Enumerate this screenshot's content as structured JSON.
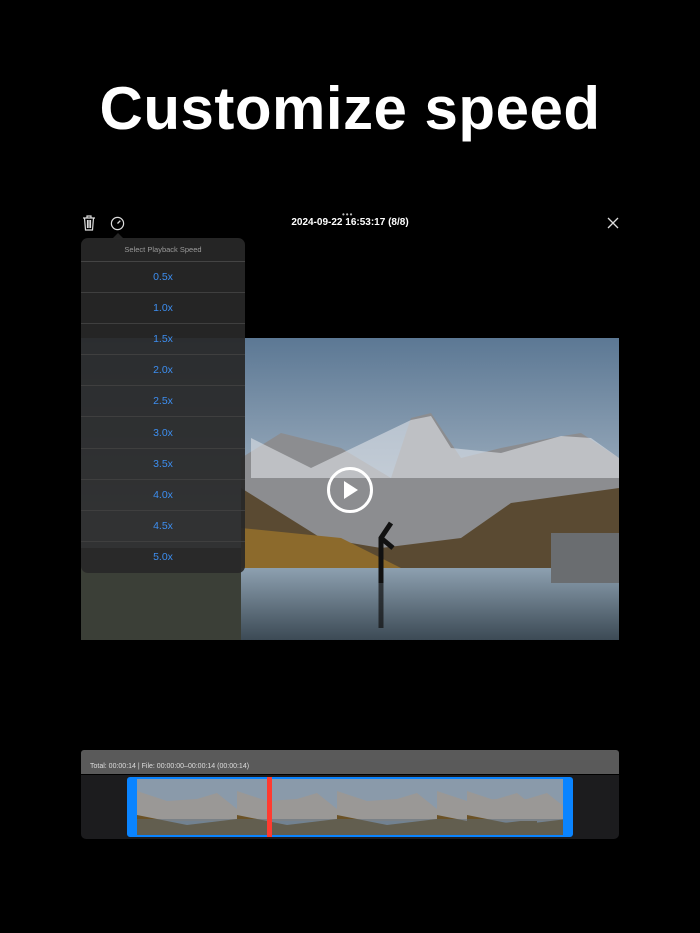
{
  "headline": "Customize speed",
  "header": {
    "title": "2024-09-22 16:53:17 (8/8)",
    "dots": "•••"
  },
  "speed_menu": {
    "title": "Select Playback Speed",
    "options": [
      "0.5x",
      "1.0x",
      "1.5x",
      "2.0x",
      "2.5x",
      "3.0x",
      "3.5x",
      "4.0x",
      "4.5x",
      "5.0x"
    ]
  },
  "timeline": {
    "info": "Total: 00:00:14 | File: 00:00:00–00:00:14 (00:00:14)",
    "playhead_fraction": 0.31
  },
  "colors": {
    "accent": "#0a84ff",
    "playhead": "#ff3b30",
    "menu_text": "#3d8ef0"
  }
}
